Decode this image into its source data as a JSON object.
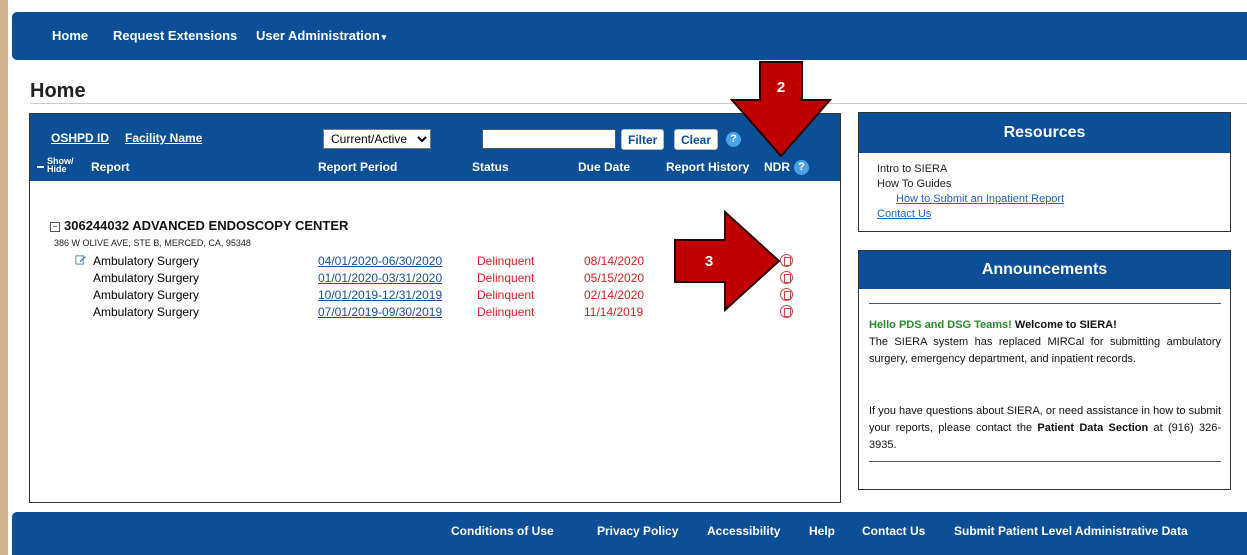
{
  "nav": {
    "home": "Home",
    "request_extensions": "Request Extensions",
    "user_admin": "User Administration"
  },
  "page": {
    "title": "Home"
  },
  "report_table": {
    "oshpd_id_label": "OSHPD ID",
    "facility_name_label": "Facility Name",
    "filter_select_value": "Current/Active",
    "filter_button": "Filter",
    "clear_button": "Clear",
    "show_label": "Show/",
    "hide_label": "Hide",
    "columns": {
      "report": "Report",
      "report_period": "Report Period",
      "status": "Status",
      "due_date": "Due Date",
      "report_history": "Report History",
      "ndr": "NDR"
    },
    "facility": {
      "header": "306244032  ADVANCED ENDOSCOPY CENTER",
      "address": "386 W OLIVE AVE, STE B, MERCED, CA, 95348"
    },
    "rows": [
      {
        "report": "Ambulatory Surgery",
        "period": "04/01/2020-06/30/2020",
        "status": "Delinquent",
        "due": "08/14/2020"
      },
      {
        "report": "Ambulatory Surgery",
        "period": "01/01/2020-03/31/2020",
        "status": "Delinquent",
        "due": "05/15/2020"
      },
      {
        "report": "Ambulatory Surgery",
        "period": "10/01/2019-12/31/2019",
        "status": "Delinquent",
        "due": "02/14/2020"
      },
      {
        "report": "Ambulatory Surgery",
        "period": "07/01/2019-09/30/2019",
        "status": "Delinquent",
        "due": "11/14/2019"
      }
    ]
  },
  "resources": {
    "title": "Resources",
    "intro": "Intro to SIERA",
    "how_to": "How To Guides",
    "inpatient_guide": "How to Submit an Inpatient Report",
    "contact": "Contact Us"
  },
  "announcements": {
    "title": "Announcements",
    "hello": "Hello PDS and DSG Teams!",
    "welcome": " Welcome to SIERA!",
    "para1": "The SIERA system has replaced MIRCal for submitting ambulatory surgery, emergency department, and inpatient records.",
    "para2_a": "If you have questions about SIERA, or need assistance in how to submit your reports, please contact the ",
    "para2_b": "Patient Data Section",
    "para2_c": " at (916) 326-3935."
  },
  "footer": {
    "conditions": "Conditions of Use",
    "privacy": "Privacy Policy",
    "accessibility": "Accessibility",
    "help": "Help",
    "contact": "Contact Us",
    "submit": "Submit Patient Level Administrative Data"
  },
  "callouts": {
    "two": "2",
    "three": "3"
  },
  "colors": {
    "brand": "#0b4f97",
    "delinquent": "#d71f1f",
    "callout": "#c00000"
  }
}
